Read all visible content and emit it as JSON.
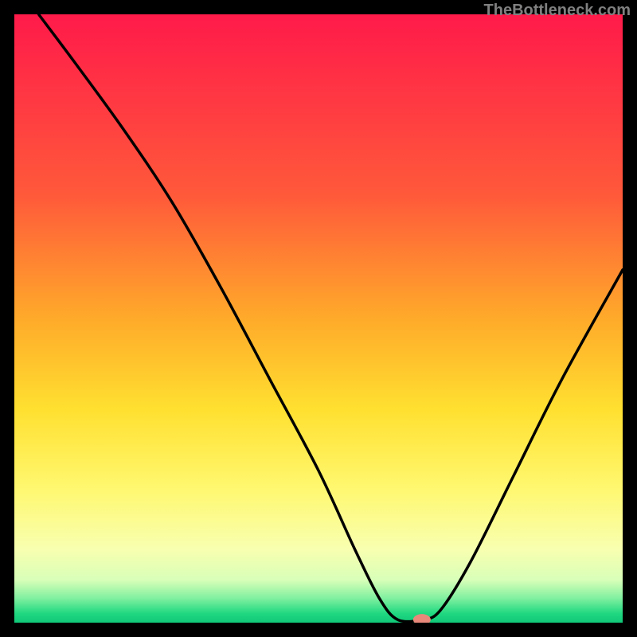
{
  "watermark": "TheBottleneck.com",
  "chart_data": {
    "type": "line",
    "title": "",
    "xlabel": "",
    "ylabel": "",
    "xlim": [
      0,
      100
    ],
    "ylim": [
      0,
      100
    ],
    "curve": [
      {
        "x": 4,
        "y": 100
      },
      {
        "x": 10,
        "y": 92
      },
      {
        "x": 18,
        "y": 81
      },
      {
        "x": 26,
        "y": 69
      },
      {
        "x": 34,
        "y": 55
      },
      {
        "x": 42,
        "y": 40
      },
      {
        "x": 50,
        "y": 25
      },
      {
        "x": 56,
        "y": 12
      },
      {
        "x": 60,
        "y": 4
      },
      {
        "x": 63,
        "y": 0.5
      },
      {
        "x": 67,
        "y": 0.5
      },
      {
        "x": 70,
        "y": 2
      },
      {
        "x": 75,
        "y": 10
      },
      {
        "x": 82,
        "y": 24
      },
      {
        "x": 90,
        "y": 40
      },
      {
        "x": 100,
        "y": 58
      }
    ],
    "marker": {
      "x": 67,
      "y": 0.5
    },
    "gradient_stops": [
      {
        "offset": 0,
        "color": "#ff1a4a"
      },
      {
        "offset": 0.3,
        "color": "#ff5a3a"
      },
      {
        "offset": 0.5,
        "color": "#ffaa2a"
      },
      {
        "offset": 0.65,
        "color": "#ffe030"
      },
      {
        "offset": 0.78,
        "color": "#fff870"
      },
      {
        "offset": 0.88,
        "color": "#f8ffb0"
      },
      {
        "offset": 0.93,
        "color": "#d8ffb8"
      },
      {
        "offset": 0.96,
        "color": "#80f0a0"
      },
      {
        "offset": 0.985,
        "color": "#20d880"
      },
      {
        "offset": 1.0,
        "color": "#10c878"
      }
    ],
    "border_color": "#000000",
    "border_width": 18,
    "curve_color": "#000000",
    "curve_width": 3.5,
    "marker_color": "#e8887a",
    "marker_rx": 11,
    "marker_ry": 7
  }
}
